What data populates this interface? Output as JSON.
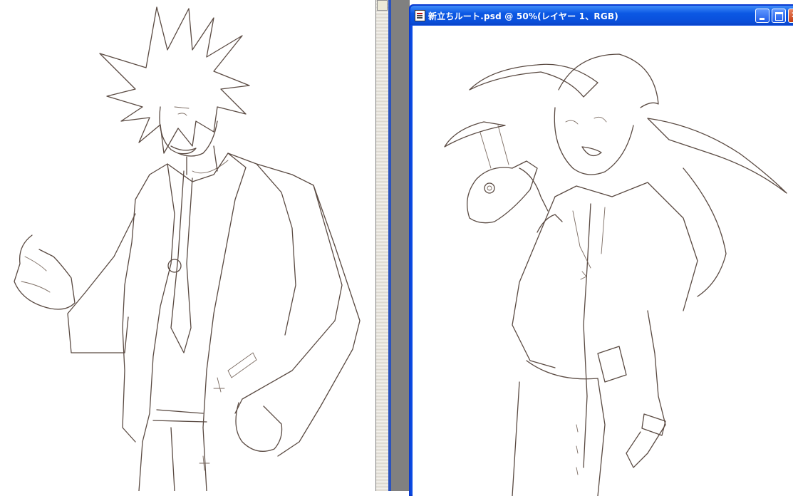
{
  "document_window": {
    "title": "新立ちルート.psd @ 50%(レイヤー 1、RGB)",
    "icon": "psd-document-icon",
    "controls": [
      "minimize-icon",
      "maximize-icon",
      "close-icon"
    ]
  },
  "canvas_left": {
    "content": "line-art-sketch",
    "stroke_color": "#5a4a42"
  },
  "canvas_right": {
    "content": "line-art-sketch",
    "stroke_color": "#5a4a42"
  },
  "colors": {
    "workspace": "#808080",
    "titlebar": "#0b58e4"
  }
}
